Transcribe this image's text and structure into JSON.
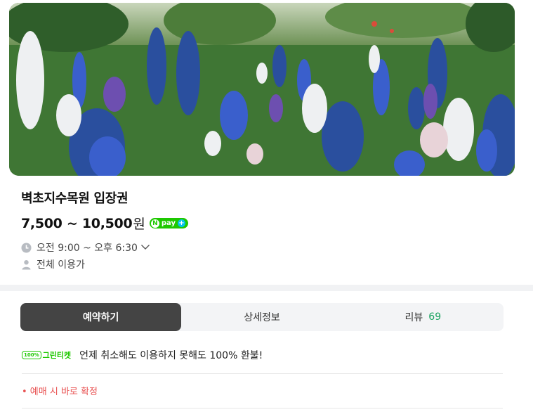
{
  "hero": {
    "image_alt": "delphinium flower garden"
  },
  "product": {
    "title": "벽초지수목원 입장권",
    "price": "7,500 ~ 10,500",
    "currency": "원",
    "npay": {
      "n": "N",
      "label": "pay",
      "plus": "+"
    }
  },
  "info": {
    "hours": "오전 9:00 ~ 오후 6:30",
    "audience": "전체 이용가",
    "icons": {
      "hours": "clock-icon",
      "audience": "person-icon",
      "expand": "chevron-down-icon"
    }
  },
  "tabs": [
    {
      "label": "예약하기",
      "active": true
    },
    {
      "label": "상세정보",
      "active": false
    },
    {
      "label": "리뷰",
      "count": "69",
      "active": false
    }
  ],
  "refund": {
    "badge_pct": "100%",
    "badge_label": "그린티켓",
    "text": "언제 취소해도 이용하지 못해도 100% 환불!"
  },
  "notice": {
    "confirm": "• 예매 시 바로 확정"
  },
  "colors": {
    "accent": "#1ec800",
    "active_tab": "#444444",
    "review_count": "#1aa360",
    "notice": "#e85050"
  }
}
